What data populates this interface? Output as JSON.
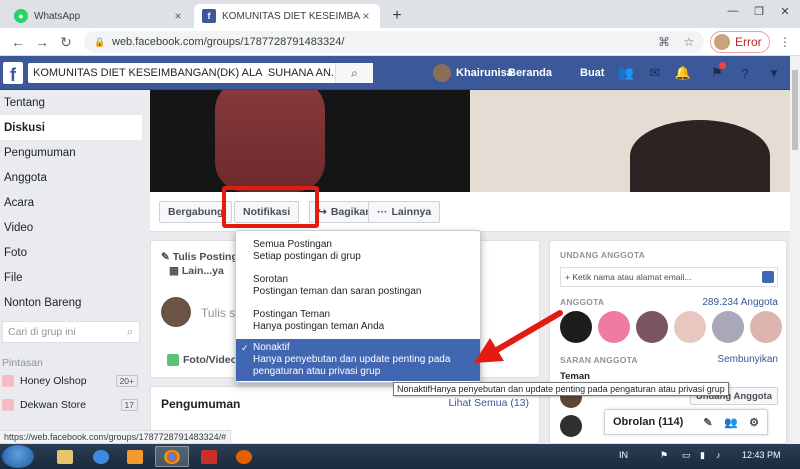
{
  "browser": {
    "tabs": [
      {
        "title": "WhatsApp",
        "icon": "whatsapp-icon"
      },
      {
        "title": "KOMUNITAS DIET KESEIMBANGAN",
        "icon": "facebook-icon"
      }
    ],
    "new_tab": "+",
    "url": "web.facebook.com/groups/1787728791483324/",
    "profile_status": "Error",
    "status_url": "https://web.facebook.com/groups/1787728791483324/#"
  },
  "fb": {
    "logo": "f",
    "search_value": "KOMUNITAS DIET KESEIMBANGAN(DK) ALA  SUHANA AN...",
    "user_name": "Khairunisa",
    "nav_home": "Beranda",
    "nav_create": "Buat"
  },
  "sidebar": {
    "items": [
      {
        "label": "Tentang"
      },
      {
        "label": "Diskusi"
      },
      {
        "label": "Pengumuman"
      },
      {
        "label": "Anggota"
      },
      {
        "label": "Acara"
      },
      {
        "label": "Video"
      },
      {
        "label": "Foto"
      },
      {
        "label": "File"
      },
      {
        "label": "Nonton Bareng"
      }
    ],
    "search_placeholder": "Cari di grup ini",
    "shortcuts_heading": "Pintasan",
    "shortcuts": [
      {
        "label": "Honey Olshop",
        "count": "20+"
      },
      {
        "label": "Dekwan Store",
        "count": "17"
      }
    ]
  },
  "group_actions": {
    "join": "Bergabung",
    "notifications": "Notifikasi",
    "share": "Bagikan",
    "more": "Lainnya"
  },
  "composer": {
    "tab_write": "Tulis Postingan",
    "tab_live": "Lain...ya",
    "placeholder": "Tulis sesuatu...",
    "photo_video": "Foto/Video"
  },
  "announcements": {
    "title": "Pengumuman",
    "see_all": "Lihat Semua (13)"
  },
  "right_col": {
    "invite_heading": "UNDANG ANGGOTA",
    "invite_placeholder": "+ Ketik nama atau alamat email...",
    "members_heading": "ANGGOTA",
    "members_count": "289.234 Anggota",
    "suggested_heading": "SARAN ANGGOTA",
    "hide": "Sembunyikan",
    "friends_label": "Teman",
    "add_member": "Undang Anggota"
  },
  "chat": {
    "label": "Obrolan (114)"
  },
  "notification_menu": {
    "options": [
      {
        "title": "Semua Postingan",
        "desc": "Setiap postingan di grup"
      },
      {
        "title": "Sorotan",
        "desc": "Postingan teman dan saran postingan"
      },
      {
        "title": "Postingan Teman",
        "desc": "Hanya postingan teman Anda"
      },
      {
        "title": "Nonaktif",
        "desc": "Hanya penyebutan dan update penting pada pengaturan atau privasi grup",
        "selected": true
      }
    ],
    "check": "✓"
  },
  "tooltip": "NonaktifHanya penyebutan dan update penting pada pengaturan atau privasi grup",
  "taskbar": {
    "lang": "IN",
    "time": "12:43 PM"
  },
  "colors": {
    "fb_blue": "#3b5998",
    "highlight_red": "#e41b13",
    "selected_blue": "#4267b2"
  }
}
